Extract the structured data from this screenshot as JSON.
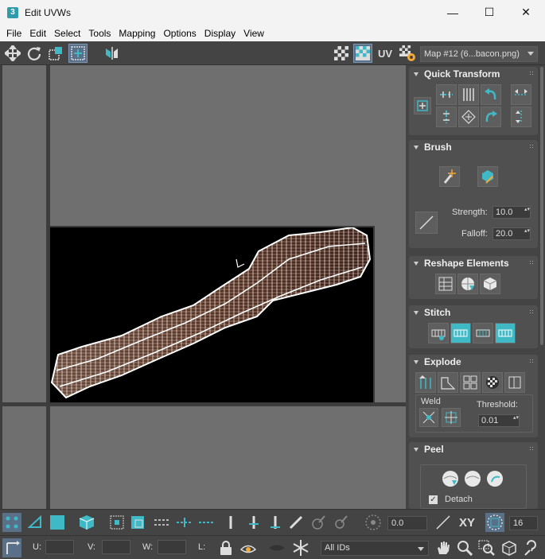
{
  "window": {
    "app_icon": "3",
    "title": "Edit UVWs",
    "controls": [
      "—",
      "☐",
      "✕"
    ]
  },
  "menu": [
    "File",
    "Edit",
    "Select",
    "Tools",
    "Mapping",
    "Options",
    "Display",
    "View"
  ],
  "toolbar": {
    "uv_label": "UV",
    "map_select": "Map #12 (6...bacon.png)"
  },
  "panel": {
    "quick_transform": {
      "title": "Quick Transform"
    },
    "brush": {
      "title": "Brush",
      "strength_label": "Strength:",
      "strength_value": "10.0",
      "falloff_label": "Falloff:",
      "falloff_value": "20.0"
    },
    "reshape": {
      "title": "Reshape Elements"
    },
    "stitch": {
      "title": "Stitch"
    },
    "explode": {
      "title": "Explode",
      "weld_label": "Weld",
      "threshold_label": "Threshold:",
      "threshold_value": "0.01"
    },
    "peel": {
      "title": "Peel",
      "detach_label": "Detach",
      "detach_checked": true
    }
  },
  "bottom": {
    "angle_value": "0.0",
    "xy_label": "XY",
    "grid_value": "16",
    "u_label": "U:",
    "v_label": "V:",
    "w_label": "W:",
    "l_label": "L:",
    "ids_select": "All IDs"
  },
  "colors": {
    "accent_teal": "#3fb9c6",
    "background": "#444444",
    "viewport": "#6f6f6f",
    "titlebar": "#f3f3f3"
  }
}
